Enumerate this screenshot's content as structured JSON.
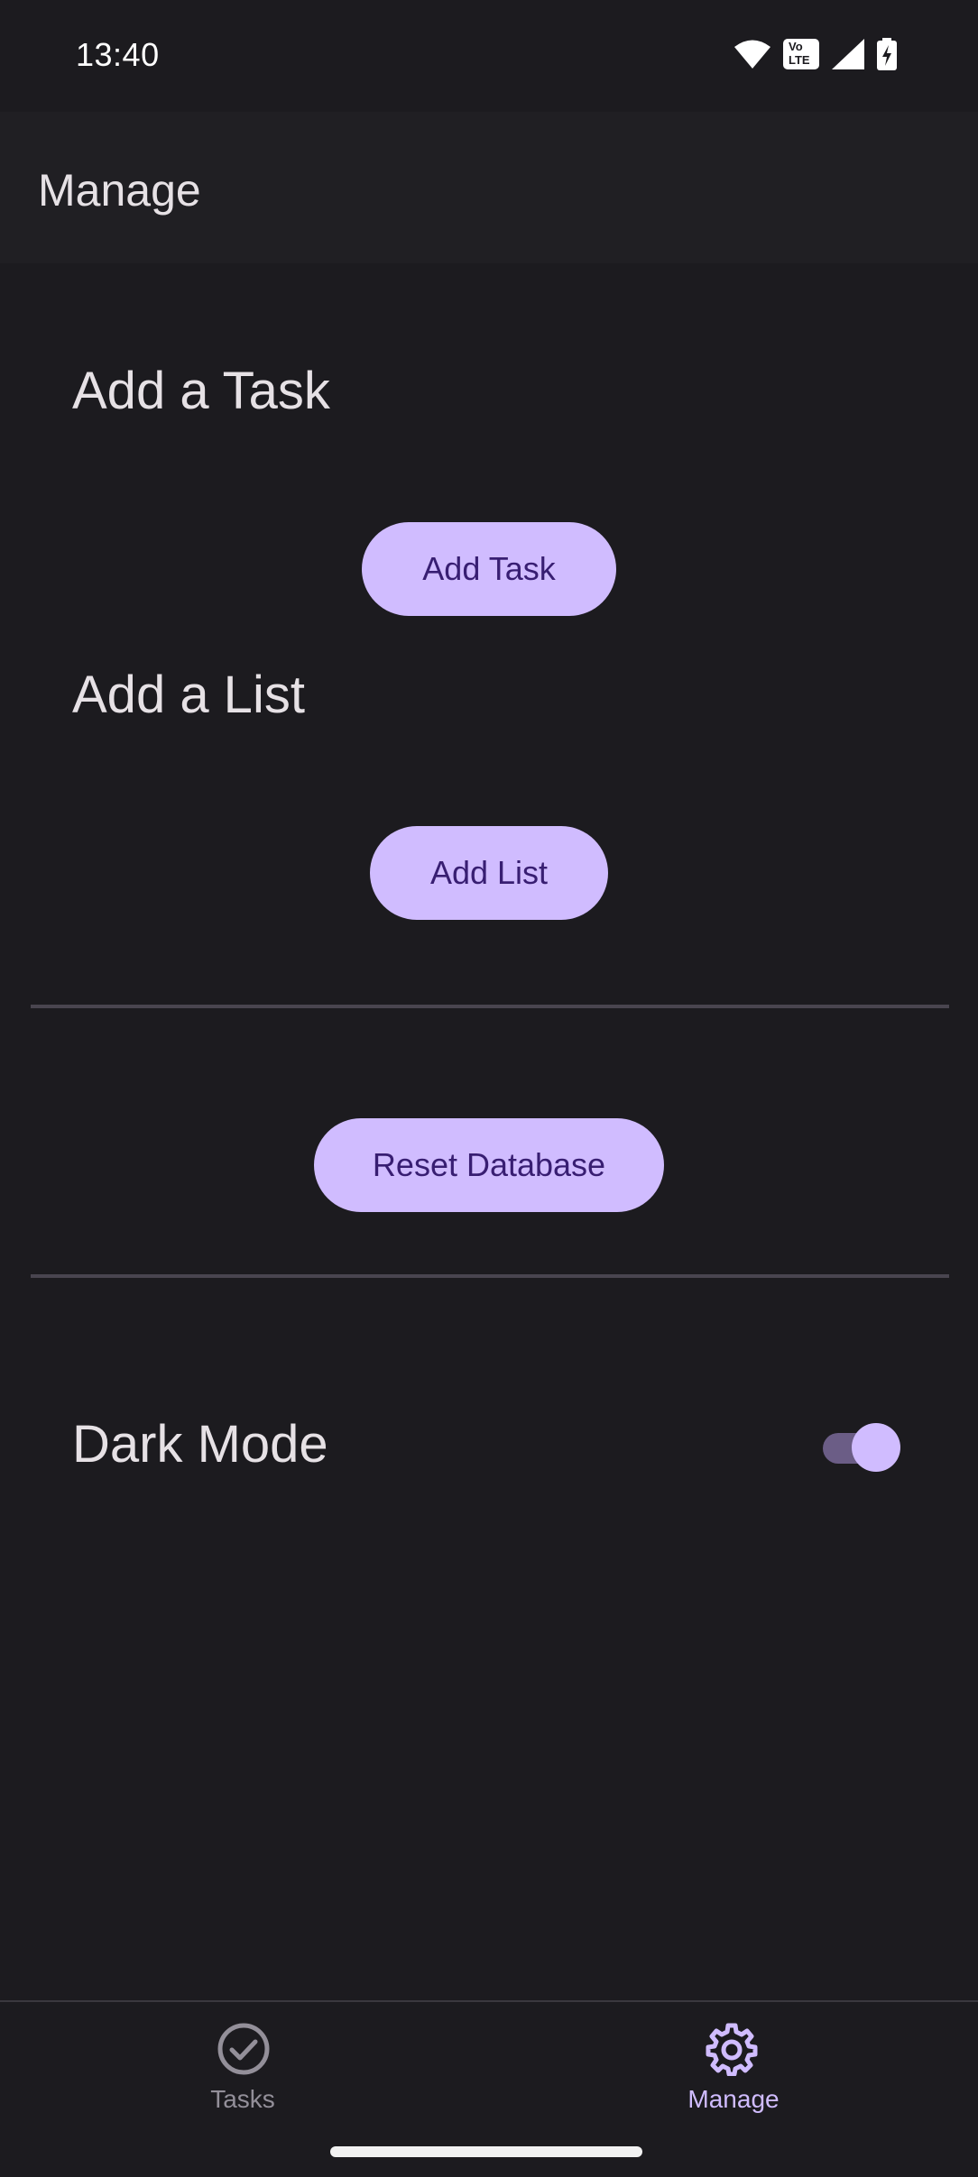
{
  "status_bar": {
    "time": "13:40",
    "icons": [
      "wifi-icon",
      "volte-icon",
      "signal-icon",
      "battery-charging-icon"
    ],
    "volte_text_top": "Vo",
    "volte_text_bottom": "LTE"
  },
  "app_bar": {
    "title": "Manage"
  },
  "sections": {
    "add_task": {
      "heading": "Add a Task",
      "button_label": "Add Task"
    },
    "add_list": {
      "heading": "Add a List",
      "button_label": "Add List"
    },
    "reset": {
      "button_label": "Reset Database"
    },
    "dark_mode": {
      "label": "Dark Mode",
      "enabled": true
    }
  },
  "bottom_nav": {
    "items": [
      {
        "label": "Tasks",
        "icon": "check-circle-icon",
        "selected": false
      },
      {
        "label": "Manage",
        "icon": "gear-icon",
        "selected": true
      }
    ]
  },
  "colors": {
    "background": "#1c1b1f",
    "app_bar": "#201f23",
    "accent": "#d0bcff",
    "on_accent": "#381e72",
    "inactive": "#938f99"
  }
}
